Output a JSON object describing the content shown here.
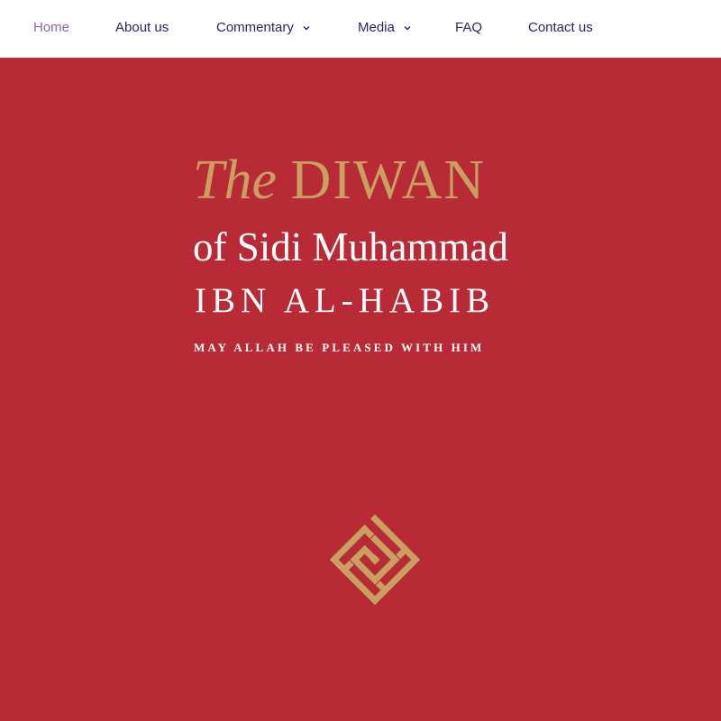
{
  "nav": {
    "items": [
      {
        "label": "Home",
        "active": true
      },
      {
        "label": "About us"
      },
      {
        "label": "Commentary",
        "has_dropdown": true
      },
      {
        "label": "Media",
        "has_dropdown": true
      },
      {
        "label": "FAQ"
      },
      {
        "label": "Contact us"
      }
    ]
  },
  "hero": {
    "title_the": "The",
    "title_diwan": "DIWAN",
    "subtitle": "of Sidi Muhammad",
    "name": "IBN AL-HABIB",
    "blessing": "MAY ALLAH BE PLEASED WITH HIM",
    "emblem_icon": "kufic-calligraphy-emblem-icon"
  },
  "colors": {
    "nav_background": "#ffffff",
    "nav_text": "#2a2466",
    "nav_active": "#8a6ab0",
    "hero_background": "#b82a36",
    "gold": "#c9a062",
    "white_text": "#ffffff"
  }
}
